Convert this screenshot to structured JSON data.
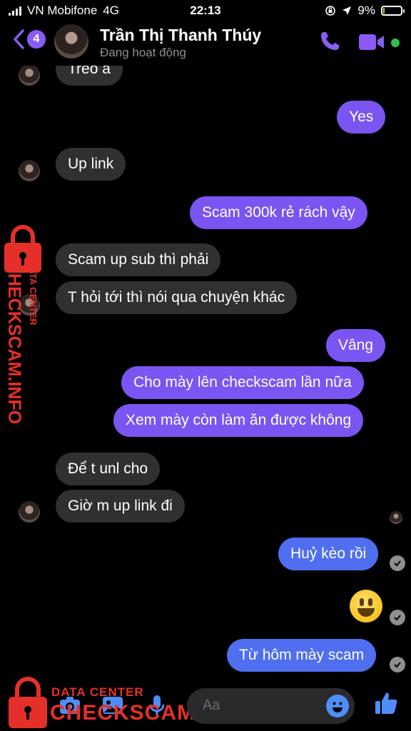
{
  "status_bar": {
    "carrier": "VN Mobifone",
    "network": "4G",
    "time": "22:13",
    "battery": "9%",
    "battery_level": 0.09
  },
  "header": {
    "unread_count": "4",
    "contact_name": "Trần Thị Thanh Thúy",
    "contact_status": "Đang hoạt động"
  },
  "messages": [
    {
      "side": "in",
      "text": "Treo à"
    },
    {
      "side": "out",
      "text": "Yes"
    },
    {
      "side": "in",
      "text": "Up link"
    },
    {
      "side": "out",
      "text": "Scam 300k rẻ rách vậy"
    },
    {
      "side": "in",
      "text": "Scam up sub thì phải"
    },
    {
      "side": "in",
      "text": "T hỏi tới thì nói qua chuyện khác"
    },
    {
      "side": "out",
      "text": "Vâng"
    },
    {
      "side": "out",
      "text": "Cho mày lên checkscam lần nữa"
    },
    {
      "side": "out",
      "text": "Xem mày còn làm ăn được không"
    },
    {
      "side": "in",
      "text": "Để t unl cho"
    },
    {
      "side": "in",
      "text": "Giờ m up link đi"
    },
    {
      "side": "out",
      "text": "Huỷ kèo rồi"
    },
    {
      "side": "out",
      "text": "😃"
    },
    {
      "side": "out",
      "text": "Từ hôm mày scam"
    }
  ],
  "composer": {
    "placeholder": "Aa"
  },
  "watermark": {
    "line1": "DATA CENTER",
    "line2": "CHECKSCAM.INFO"
  },
  "colors": {
    "outgoing": "#7b55f2",
    "outgoing_blue": "#4f6ef0",
    "incoming": "#303030",
    "accent": "#8a5cf5",
    "watermark": "#e5302a"
  }
}
